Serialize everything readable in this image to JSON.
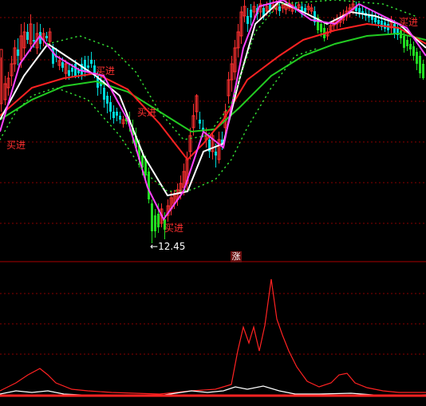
{
  "chart_data": [
    {
      "type": "candlestick",
      "title": "",
      "annotations": {
        "low_price": "12.45",
        "buy_signal_text": "买进",
        "buy_signals": [
          {
            "x": 8,
            "price_y": 186
          },
          {
            "x": 120,
            "price_y": 93
          },
          {
            "x": 172,
            "price_y": 145
          },
          {
            "x": 206,
            "price_y": 290
          },
          {
            "x": 500,
            "price_y": 32
          }
        ]
      },
      "series_colors": {
        "ma_short": "#ff44ff",
        "ma_mid": "#ffffff",
        "ma_long": "#ff2222",
        "ma_longest": "#22cc22",
        "band": "#33dd33",
        "candle_up": "#ff3030",
        "candle_down": "#00d8d8",
        "candle_down_alt": "#22dd22",
        "grid": "#8a0000"
      },
      "bars": [
        [
          0,
          62,
          130,
          72,
          140,
          "up"
        ],
        [
          5,
          105,
          125,
          95,
          132,
          "up"
        ],
        [
          9,
          110,
          98,
          90,
          120,
          "up"
        ],
        [
          13,
          95,
          80,
          70,
          108,
          "up"
        ],
        [
          17,
          80,
          60,
          50,
          90,
          "up"
        ],
        [
          21,
          70,
          62,
          48,
          82,
          "down"
        ],
        [
          25,
          75,
          45,
          30,
          85,
          "up"
        ],
        [
          29,
          60,
          40,
          28,
          70,
          "up"
        ],
        [
          33,
          50,
          40,
          30,
          55,
          "down"
        ],
        [
          37,
          55,
          30,
          18,
          65,
          "up"
        ],
        [
          41,
          50,
          52,
          30,
          60,
          "down"
        ],
        [
          45,
          60,
          42,
          28,
          68,
          "up"
        ],
        [
          49,
          55,
          40,
          30,
          62,
          "down"
        ],
        [
          53,
          50,
          42,
          35,
          58,
          "up"
        ],
        [
          57,
          48,
          45,
          40,
          52,
          "down"
        ],
        [
          61,
          52,
          40,
          35,
          56,
          "up"
        ],
        [
          65,
          60,
          80,
          55,
          85,
          "down"
        ],
        [
          69,
          70,
          72,
          60,
          78,
          "down"
        ],
        [
          73,
          82,
          76,
          70,
          88,
          "up"
        ],
        [
          77,
          85,
          78,
          72,
          90,
          "down"
        ],
        [
          81,
          92,
          80,
          75,
          100,
          "up"
        ],
        [
          85,
          95,
          88,
          80,
          100,
          "down"
        ],
        [
          89,
          90,
          85,
          80,
          96,
          "down"
        ],
        [
          93,
          95,
          80,
          75,
          98,
          "down"
        ],
        [
          97,
          88,
          92,
          85,
          98,
          "down"
        ],
        [
          101,
          80,
          95,
          72,
          100,
          "down"
        ],
        [
          105,
          90,
          75,
          70,
          96,
          "down"
        ],
        [
          109,
          85,
          82,
          70,
          90,
          "down"
        ],
        [
          113,
          75,
          80,
          65,
          85,
          "down"
        ],
        [
          117,
          82,
          92,
          75,
          98,
          "down"
        ],
        [
          121,
          95,
          110,
          90,
          120,
          "down"
        ],
        [
          125,
          100,
          108,
          95,
          118,
          "down"
        ],
        [
          129,
          110,
          125,
          100,
          135,
          "down"
        ],
        [
          133,
          120,
          130,
          115,
          142,
          "down"
        ],
        [
          137,
          128,
          140,
          120,
          150,
          "down"
        ],
        [
          141,
          140,
          148,
          132,
          155,
          "down"
        ],
        [
          145,
          140,
          145,
          135,
          152,
          "down"
        ],
        [
          149,
          145,
          150,
          140,
          155,
          "down"
        ],
        [
          153,
          150,
          155,
          145,
          160,
          "up"
        ],
        [
          157,
          148,
          152,
          142,
          156,
          "down"
        ],
        [
          161,
          150,
          155,
          140,
          165,
          "down"
        ],
        [
          165,
          160,
          170,
          150,
          180,
          "down"
        ],
        [
          169,
          170,
          185,
          160,
          190,
          "down"
        ],
        [
          173,
          182,
          200,
          175,
          210,
          "down"
        ],
        [
          177,
          195,
          210,
          188,
          220,
          "down"
        ],
        [
          181,
          200,
          220,
          195,
          225,
          "down"
        ],
        [
          185,
          215,
          250,
          210,
          255,
          "down"
        ],
        [
          189,
          255,
          290,
          250,
          305,
          "down"
        ],
        [
          193,
          270,
          290,
          262,
          298,
          "down"
        ],
        [
          197,
          268,
          285,
          255,
          292,
          "down"
        ],
        [
          201,
          262,
          280,
          255,
          285,
          "up"
        ],
        [
          205,
          275,
          288,
          266,
          300,
          "down"
        ],
        [
          209,
          270,
          258,
          250,
          278,
          "up"
        ],
        [
          213,
          262,
          248,
          240,
          270,
          "up"
        ],
        [
          217,
          255,
          245,
          238,
          262,
          "up"
        ],
        [
          221,
          250,
          238,
          230,
          258,
          "up"
        ],
        [
          225,
          242,
          230,
          220,
          250,
          "up"
        ],
        [
          229,
          235,
          215,
          205,
          245,
          "up"
        ],
        [
          233,
          230,
          200,
          190,
          240,
          "up"
        ],
        [
          237,
          190,
          170,
          160,
          200,
          "up"
        ],
        [
          241,
          160,
          145,
          130,
          170,
          "up"
        ],
        [
          245,
          140,
          120,
          118,
          150,
          "up"
        ],
        [
          249,
          150,
          155,
          140,
          162,
          "down"
        ],
        [
          253,
          165,
          160,
          150,
          172,
          "down"
        ],
        [
          257,
          168,
          175,
          160,
          185,
          "up"
        ],
        [
          261,
          175,
          190,
          170,
          198,
          "down"
        ],
        [
          265,
          190,
          170,
          165,
          200,
          "up"
        ],
        [
          269,
          190,
          195,
          180,
          210,
          "down"
        ],
        [
          273,
          200,
          175,
          165,
          205,
          "up"
        ],
        [
          277,
          175,
          180,
          165,
          188,
          "down"
        ],
        [
          281,
          160,
          140,
          130,
          170,
          "up"
        ],
        [
          285,
          120,
          100,
          90,
          130,
          "up"
        ],
        [
          289,
          100,
          80,
          70,
          115,
          "up"
        ],
        [
          293,
          90,
          60,
          50,
          100,
          "up"
        ],
        [
          297,
          60,
          40,
          30,
          72,
          "up"
        ],
        [
          301,
          45,
          15,
          8,
          55,
          "up"
        ],
        [
          305,
          20,
          8,
          0,
          28,
          "up"
        ],
        [
          309,
          30,
          20,
          10,
          40,
          "down"
        ],
        [
          313,
          22,
          12,
          5,
          32,
          "down"
        ],
        [
          317,
          15,
          8,
          2,
          25,
          "up"
        ],
        [
          321,
          10,
          18,
          5,
          25,
          "down"
        ],
        [
          325,
          15,
          5,
          0,
          22,
          "up"
        ],
        [
          329,
          10,
          20,
          5,
          25,
          "down"
        ],
        [
          333,
          8,
          14,
          2,
          20,
          "up"
        ],
        [
          337,
          5,
          12,
          0,
          18,
          "down"
        ],
        [
          341,
          6,
          10,
          0,
          15,
          "up"
        ],
        [
          345,
          5,
          12,
          0,
          18,
          "up"
        ],
        [
          349,
          8,
          14,
          3,
          20,
          "down"
        ],
        [
          353,
          6,
          10,
          2,
          16,
          "up"
        ],
        [
          357,
          5,
          12,
          0,
          18,
          "up"
        ],
        [
          361,
          4,
          10,
          0,
          14,
          "up"
        ],
        [
          365,
          6,
          14,
          2,
          18,
          "up"
        ],
        [
          369,
          8,
          12,
          3,
          16,
          "down"
        ],
        [
          373,
          6,
          10,
          2,
          14,
          "up"
        ],
        [
          377,
          8,
          18,
          4,
          22,
          "down"
        ],
        [
          381,
          10,
          15,
          5,
          20,
          "down"
        ],
        [
          385,
          8,
          12,
          4,
          18,
          "up"
        ],
        [
          389,
          10,
          14,
          5,
          18,
          "up"
        ],
        [
          393,
          14,
          28,
          8,
          32,
          "down"
        ],
        [
          397,
          22,
          38,
          18,
          42,
          "down"
        ],
        [
          401,
          30,
          40,
          25,
          46,
          "down"
        ],
        [
          405,
          35,
          48,
          28,
          52,
          "down"
        ],
        [
          409,
          40,
          45,
          35,
          50,
          "up"
        ],
        [
          413,
          38,
          32,
          28,
          42,
          "up"
        ],
        [
          417,
          32,
          28,
          22,
          38,
          "up"
        ],
        [
          421,
          30,
          25,
          18,
          36,
          "up"
        ],
        [
          425,
          28,
          22,
          15,
          34,
          "up"
        ],
        [
          429,
          25,
          18,
          12,
          30,
          "up"
        ],
        [
          433,
          20,
          14,
          8,
          26,
          "up"
        ],
        [
          437,
          16,
          10,
          5,
          22,
          "up"
        ],
        [
          441,
          12,
          5,
          0,
          18,
          "up"
        ],
        [
          445,
          8,
          14,
          2,
          20,
          "down"
        ],
        [
          449,
          10,
          16,
          5,
          22,
          "down"
        ],
        [
          453,
          14,
          18,
          8,
          24,
          "down"
        ],
        [
          457,
          16,
          20,
          10,
          26,
          "down"
        ],
        [
          461,
          18,
          22,
          12,
          28,
          "down"
        ],
        [
          465,
          20,
          25,
          14,
          30,
          "down"
        ],
        [
          469,
          22,
          28,
          15,
          32,
          "down"
        ],
        [
          473,
          25,
          30,
          18,
          35,
          "down"
        ],
        [
          477,
          26,
          34,
          20,
          38,
          "down"
        ],
        [
          481,
          28,
          36,
          22,
          40,
          "down"
        ],
        [
          485,
          30,
          38,
          22,
          44,
          "down"
        ],
        [
          489,
          25,
          35,
          20,
          42,
          "up"
        ],
        [
          493,
          30,
          42,
          25,
          48,
          "down"
        ],
        [
          497,
          35,
          44,
          28,
          50,
          "down"
        ],
        [
          501,
          38,
          48,
          30,
          55,
          "down"
        ],
        [
          505,
          45,
          60,
          40,
          66,
          "down"
        ],
        [
          509,
          50,
          58,
          44,
          64,
          "down"
        ],
        [
          513,
          55,
          62,
          48,
          70,
          "down"
        ],
        [
          517,
          58,
          70,
          52,
          76,
          "down"
        ],
        [
          521,
          65,
          80,
          60,
          88,
          "down"
        ],
        [
          525,
          70,
          92,
          64,
          98,
          "down"
        ],
        [
          529,
          80,
          98,
          75,
          100,
          "down"
        ]
      ]
    },
    {
      "type": "line",
      "title": "",
      "annotations": {
        "label": "涨"
      },
      "series": [
        {
          "color": "#ff2222"
        },
        {
          "color": "#ffffff"
        }
      ]
    }
  ]
}
